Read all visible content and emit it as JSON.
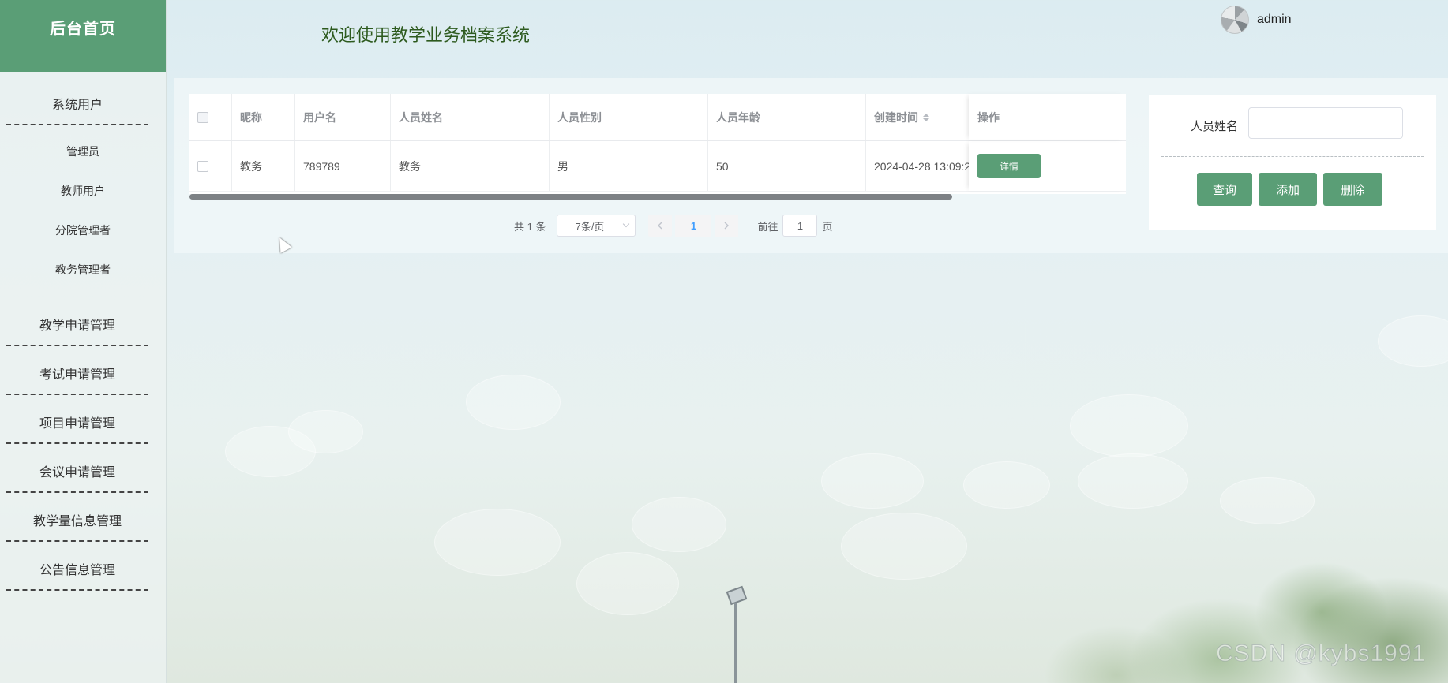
{
  "sidebar": {
    "title": "后台首页",
    "groups": [
      {
        "label": "系统用户",
        "items": [
          "管理员",
          "教师用户",
          "分院管理者",
          "教务管理者"
        ]
      },
      {
        "label": "教学申请管理"
      },
      {
        "label": "考试申请管理"
      },
      {
        "label": "项目申请管理"
      },
      {
        "label": "会议申请管理"
      },
      {
        "label": "教学量信息管理"
      },
      {
        "label": "公告信息管理"
      }
    ]
  },
  "header": {
    "title": "欢迎使用教学业务档案系统",
    "username": "admin",
    "avatar_icon": "avatar-icon"
  },
  "table": {
    "columns": [
      "昵称",
      "用户名",
      "人员姓名",
      "人员性别",
      "人员年龄",
      "创建时间",
      "操作"
    ],
    "rows": [
      {
        "nickname": "教务",
        "username": "789789",
        "name": "教务",
        "gender": "男",
        "age": "50",
        "created": "2024-04-28 13:09:2",
        "action": "详情"
      }
    ]
  },
  "pagination": {
    "total": "共 1 条",
    "page_size": "7条/页",
    "current": "1",
    "goto_label": "前往",
    "goto_value": "1",
    "page_unit": "页"
  },
  "search": {
    "label": "人员姓名",
    "placeholder": "",
    "buttons": {
      "query": "查询",
      "add": "添加",
      "delete": "删除"
    }
  },
  "watermark": "CSDN @kybs1991",
  "colors": {
    "accent": "#5a9e76",
    "title": "#2d5a1e",
    "page_active": "#409eff"
  }
}
